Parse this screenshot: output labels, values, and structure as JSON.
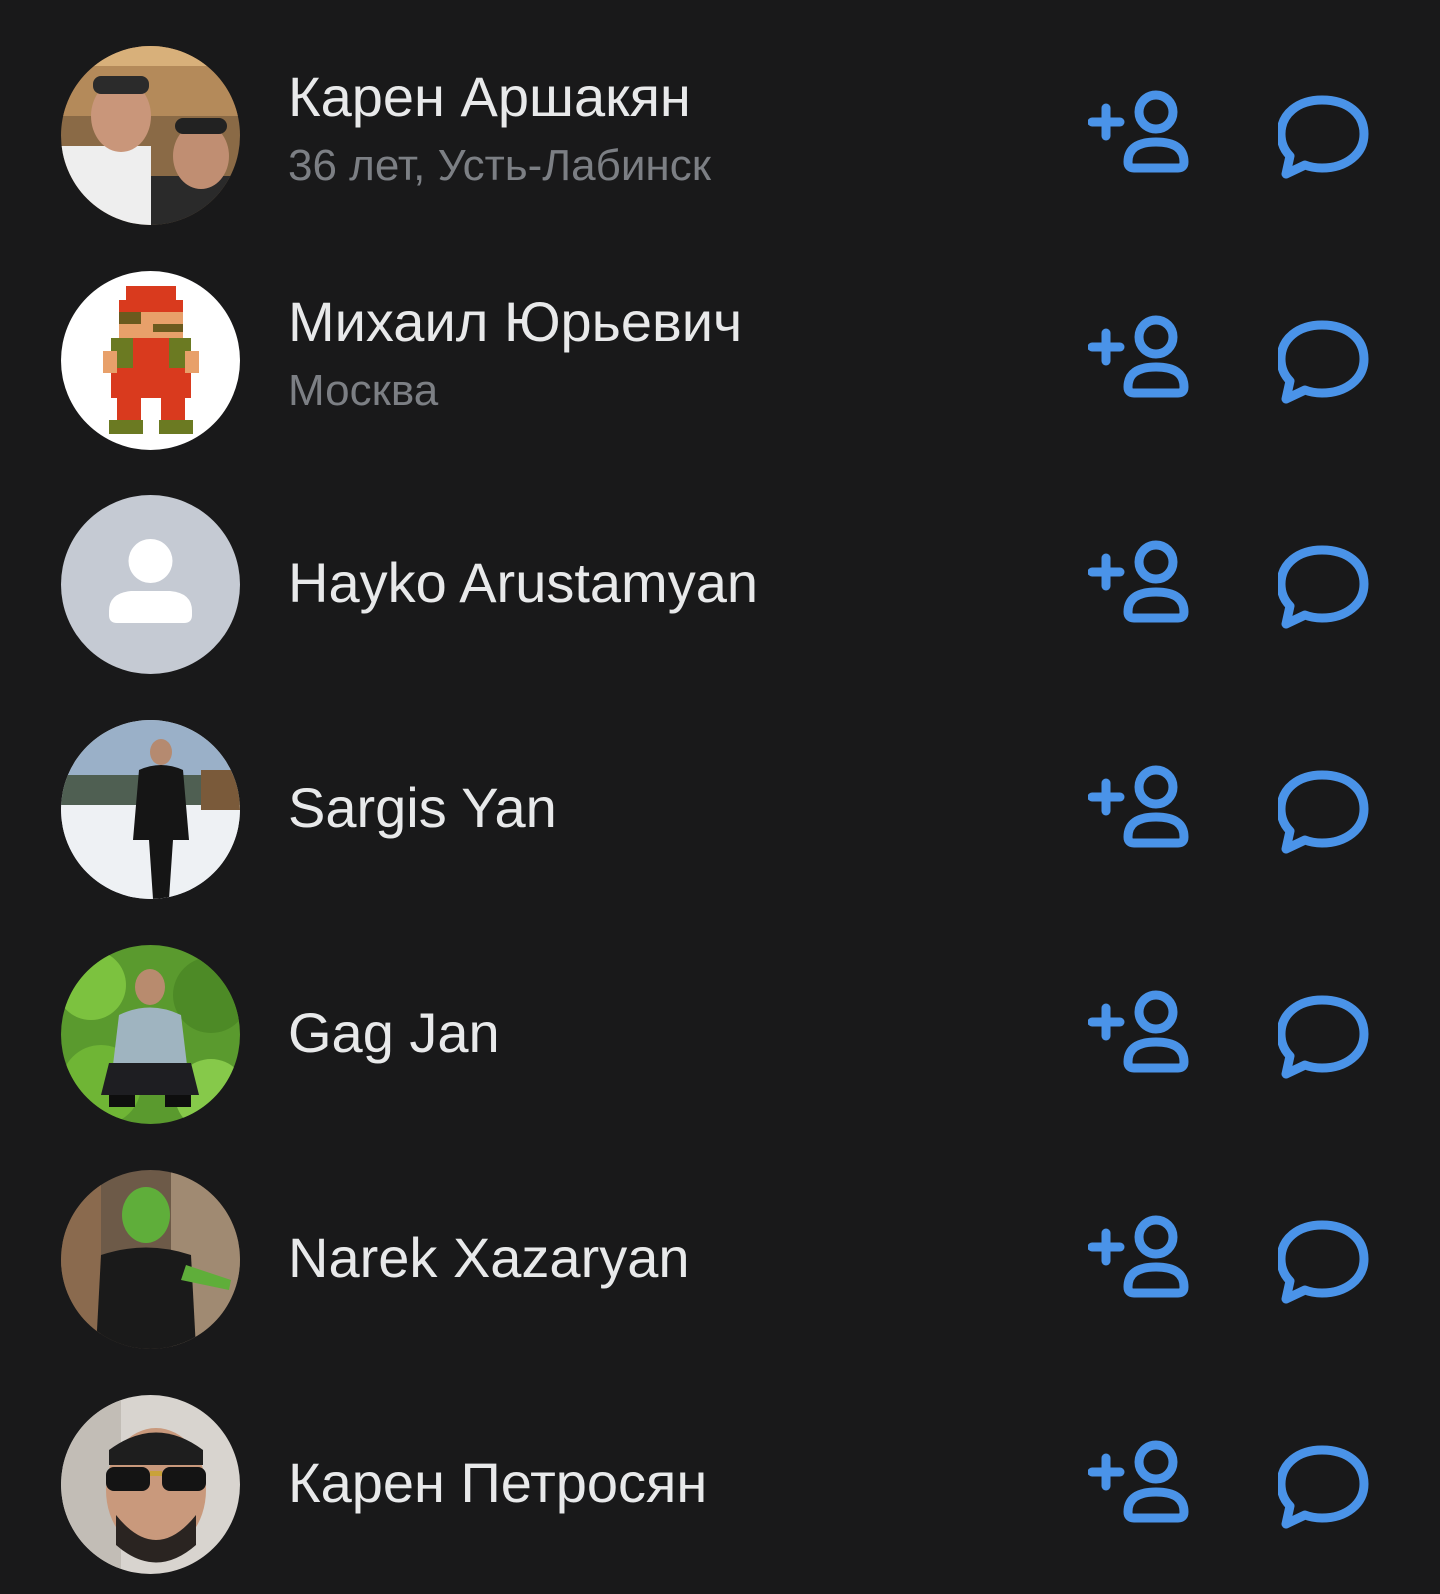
{
  "accent_color": "#4a93e8",
  "users": [
    {
      "name": "Карен Аршакян",
      "subtitle": "36 лет, Усть-Лабинск",
      "avatar": "photo-two-men"
    },
    {
      "name": "Михаил Юрьевич",
      "subtitle": "Москва",
      "avatar": "pixel-mario"
    },
    {
      "name": "Hayko Arustamyan",
      "subtitle": "",
      "avatar": "default-user-icon"
    },
    {
      "name": "Sargis Yan",
      "subtitle": "",
      "avatar": "photo-snow"
    },
    {
      "name": "Gag Jan",
      "subtitle": "",
      "avatar": "photo-greenery"
    },
    {
      "name": "Narek Xazaryan",
      "subtitle": "",
      "avatar": "photo-green-tint"
    },
    {
      "name": "Карен Петросян",
      "subtitle": "",
      "avatar": "photo-sunglasses"
    }
  ],
  "actions": {
    "add_friend_icon": "add-friend-icon",
    "message_icon": "message-icon"
  }
}
